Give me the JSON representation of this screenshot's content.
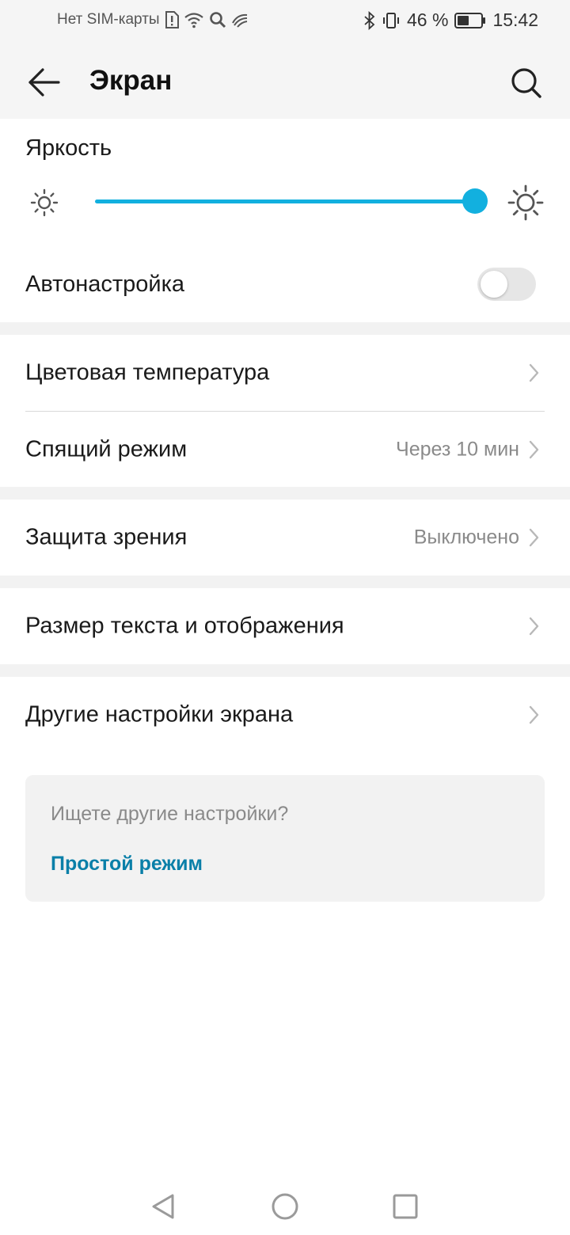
{
  "status_bar": {
    "carrier": "Нет SIM-карты",
    "battery_percent": "46 %",
    "time": "15:42",
    "icons": [
      "sim-alert-icon",
      "wifi-icon",
      "search-icon",
      "speed-icon",
      "bluetooth-icon",
      "vibrate-icon",
      "battery-icon"
    ]
  },
  "header": {
    "title": "Экран",
    "back_icon": "arrow-left-icon",
    "search_icon": "search-icon"
  },
  "brightness": {
    "label": "Яркость",
    "level": 1.0,
    "accent_color": "#12b0df"
  },
  "auto_adjust": {
    "label": "Автонастройка",
    "enabled": false
  },
  "rows": {
    "color_temperature": {
      "label": "Цветовая температура",
      "value": ""
    },
    "sleep": {
      "label": "Спящий режим",
      "value": "Через 10 мин"
    },
    "eye_comfort": {
      "label": "Защита зрения",
      "value": "Выключено"
    },
    "text_display_size": {
      "label": "Размер текста и отображения",
      "value": ""
    },
    "other_display": {
      "label": "Другие настройки экрана",
      "value": ""
    }
  },
  "hint": {
    "question": "Ищете другие настройки?",
    "link": "Простой режим",
    "link_color": "#0a7fa8"
  },
  "nav_bar": {
    "icons": [
      "nav-back-icon",
      "nav-home-icon",
      "nav-recents-icon"
    ]
  }
}
